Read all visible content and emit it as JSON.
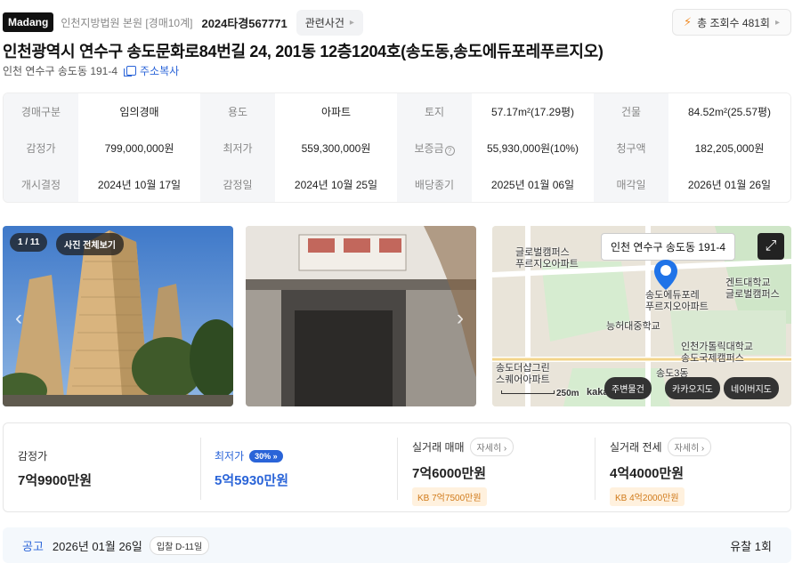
{
  "header": {
    "brand": "Madang",
    "court": "인천지방법원 본원 [경매10계]",
    "case_no": "2024타경567771",
    "related_label": "관련사건",
    "views_label": "총 조회수 481회"
  },
  "title": "인천광역시 연수구 송도문화로84번길 24, 201동 12층1204호(송도동,송도에듀포레푸르지오)",
  "address": {
    "jibun": "인천 연수구 송도동 191-4",
    "copy_label": "주소복사"
  },
  "info": {
    "rows": [
      [
        {
          "k": "경매구분",
          "v": "임의경매"
        },
        {
          "k": "용도",
          "v": "아파트"
        },
        {
          "k": "토지",
          "v": "57.17m²(17.29평)"
        },
        {
          "k": "건물",
          "v": "84.52m²(25.57평)"
        }
      ],
      [
        {
          "k": "감정가",
          "v": "799,000,000원"
        },
        {
          "k": "최저가",
          "v": "559,300,000원"
        },
        {
          "k": "보증금",
          "v": "55,930,000원(10%)"
        },
        {
          "k": "청구액",
          "v": "182,205,000원"
        }
      ],
      [
        {
          "k": "개시결정",
          "v": "2024년 10월 17일"
        },
        {
          "k": "감정일",
          "v": "2024년 10월 25일"
        },
        {
          "k": "배당종기",
          "v": "2025년 01월 06일"
        },
        {
          "k": "매각일",
          "v": "2026년 01월 26일"
        }
      ]
    ]
  },
  "gallery": {
    "counter": "1 / 11",
    "view_all": "사진 전체보기"
  },
  "map": {
    "pin_label": "인천 연수구 송도동 191-4",
    "places": [
      "글로벌캠퍼스\n푸르지오아파트",
      "송도에듀포레\n푸르지오아파트",
      "능허대중학교",
      "인천가톨릭대학교\n송도국제캠퍼스",
      "겐트대학교\n글로벌캠퍼스",
      "송도더샵그린\n스퀘어아파트",
      "송도3동"
    ],
    "scale": "250m",
    "provider": "kakao",
    "buttons": [
      "주변물건",
      "카카오지도",
      "네이버지도"
    ]
  },
  "prices": {
    "appraisal": {
      "label": "감정가",
      "value": "7억9900만원"
    },
    "minimum": {
      "label": "최저가",
      "pct": "30%",
      "value": "5억5930만원"
    },
    "sale": {
      "label": "실거래 매매",
      "detail": "자세히",
      "value": "7억6000만원",
      "kb": "KB 7억7500만원"
    },
    "jeonse": {
      "label": "실거래 전세",
      "detail": "자세히",
      "value": "4억4000만원",
      "kb": "KB 4억2000만원"
    }
  },
  "notice": {
    "label": "공고",
    "date": "2026년 01월 26일",
    "dday": "입찰 D-11일",
    "fail": "유찰 1회"
  },
  "colors": {
    "accent": "#2a64d8",
    "kb_bg": "#fff1de",
    "kb_text": "#d07a1a"
  }
}
